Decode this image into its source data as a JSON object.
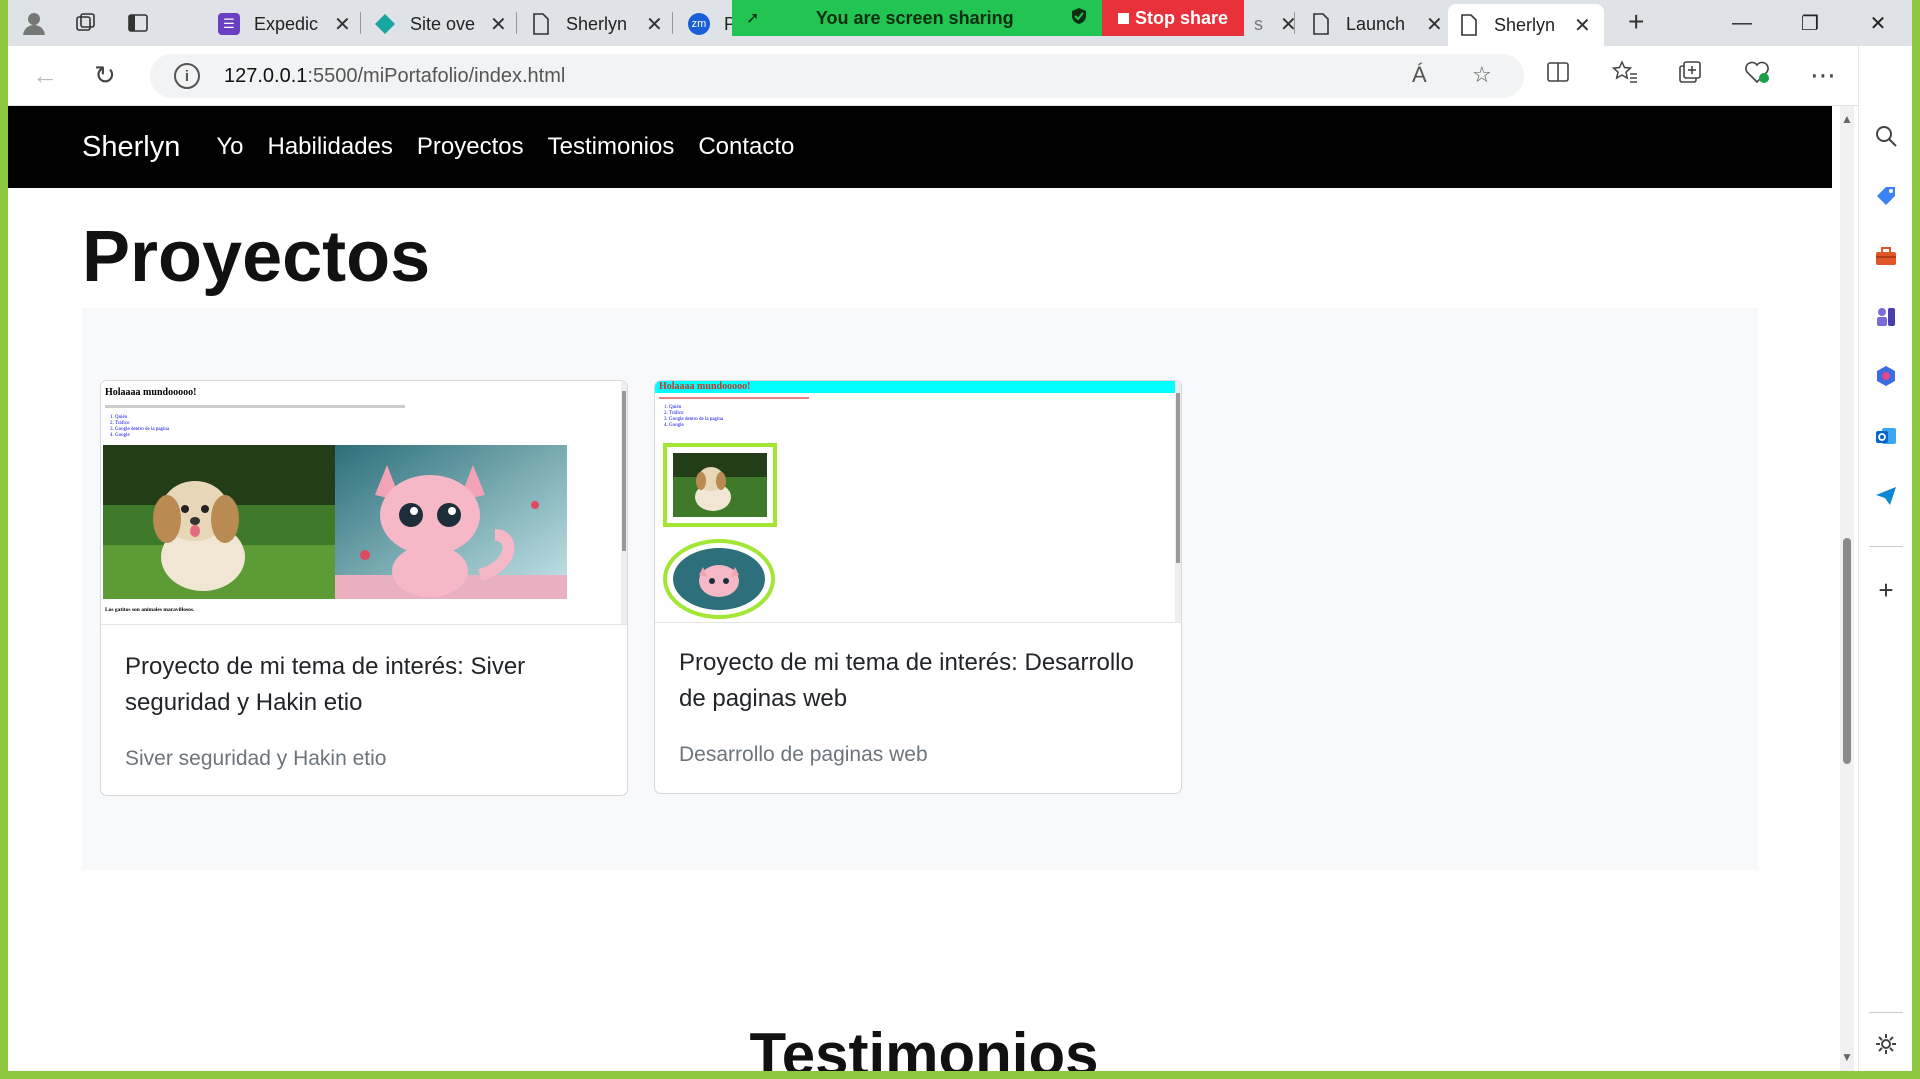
{
  "browser": {
    "tabs": [
      {
        "title": "Expedic",
        "icon": "form-icon"
      },
      {
        "title": "Site ove",
        "icon": "diamond-icon"
      },
      {
        "title": "Sherlyn",
        "icon": "page-icon"
      },
      {
        "title": "Launch",
        "icon": "page-icon"
      },
      {
        "title": "Sherlyn",
        "icon": "page-icon"
      }
    ],
    "zoom_tab_title": "P",
    "zoom_badge": "zm",
    "hidden_tab_suffix": "s",
    "share_banner": "You are screen sharing",
    "stop_share": "Stop share",
    "url_host": "127.0.0.1",
    "url_path": ":5500/miPortafolio/index.html",
    "read_aloud_glyph": "Á"
  },
  "page": {
    "brand": "Sherlyn",
    "nav": [
      "Yo",
      "Habilidades",
      "Proyectos",
      "Testimonios",
      "Contacto"
    ],
    "projects_heading": "Proyectos",
    "testimonials_heading": "Testimonios",
    "projects": [
      {
        "title": "Proyecto de mi tema de interés: Siver seguridad y Hakin etio",
        "subtitle": "Siver seguridad y Hakin etio",
        "preview_heading": "Holaaaa mundooooo!",
        "preview_caption": "Los gatitos son animales maravillosos.",
        "preview_list": [
          "Quién",
          "Tráfico",
          "Google dentro de la pagina",
          "Google"
        ]
      },
      {
        "title": "Proyecto de mi tema de interés: Desarrollo de paginas web",
        "subtitle": "Desarrollo de paginas web",
        "preview_heading": "Holaaaa mundooooo!",
        "preview_list": [
          "Quién",
          "Tráfico",
          "Google dentro de la pagina",
          "Google"
        ]
      }
    ]
  },
  "colors": {
    "frame": "#8dc63f",
    "share_green": "#23c552",
    "stop_red": "#e8313b",
    "navbar": "#000000",
    "preview_cyan": "#00ffff",
    "preview_frame": "#a3e635"
  }
}
